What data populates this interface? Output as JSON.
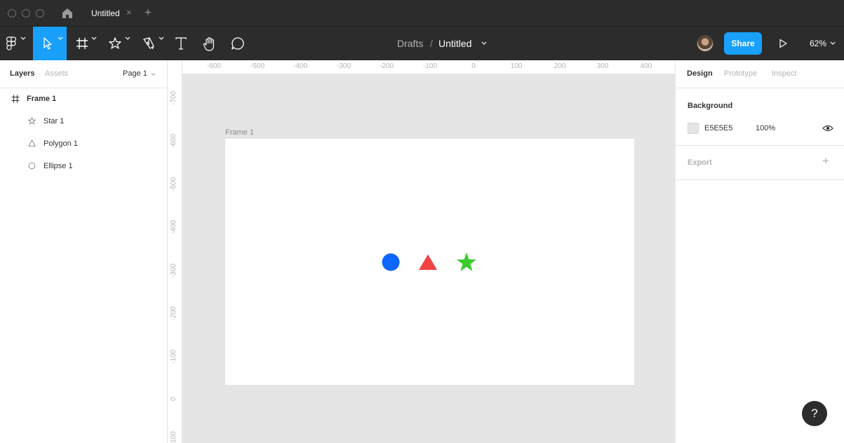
{
  "titlebar": {
    "tab_title": "Untitled",
    "tab_close": "×",
    "new_tab": "+"
  },
  "toolbar": {
    "breadcrumb_project": "Drafts",
    "breadcrumb_sep": "/",
    "file_name": "Untitled",
    "share_label": "Share",
    "zoom": "62%",
    "tools": [
      "main-menu",
      "move",
      "frame",
      "shape",
      "pen",
      "text",
      "hand",
      "comment"
    ],
    "active_tool": "move"
  },
  "left_panel": {
    "tabs": [
      "Layers",
      "Assets"
    ],
    "active_tab": "Layers",
    "page_selector": "Page 1",
    "layers": [
      {
        "name": "Frame 1",
        "icon": "frame-icon",
        "level": 0
      },
      {
        "name": "Star 1",
        "icon": "star-icon",
        "level": 1
      },
      {
        "name": "Polygon 1",
        "icon": "polygon-icon",
        "level": 1
      },
      {
        "name": "Ellipse 1",
        "icon": "ellipse-icon",
        "level": 1
      }
    ]
  },
  "rulers": {
    "horizontal": [
      "-600",
      "-500",
      "-400",
      "-300",
      "-200",
      "-100",
      "0",
      "100",
      "200",
      "300",
      "400"
    ],
    "vertical": [
      "-700",
      "-600",
      "-500",
      "-400",
      "-300",
      "-200",
      "-100",
      "0",
      "100"
    ]
  },
  "canvas": {
    "frame_label": "Frame 1",
    "frame_fill": "#FFFFFF",
    "canvas_bg": "#E5E5E5",
    "shapes": [
      {
        "type": "ellipse",
        "color": "#0D66FF"
      },
      {
        "type": "triangle",
        "color": "#F24343"
      },
      {
        "type": "star",
        "color": "#3CCC2C"
      }
    ]
  },
  "right_panel": {
    "tabs": [
      "Design",
      "Prototype",
      "Inspect"
    ],
    "active_tab": "Design",
    "background_title": "Background",
    "background_hex": "E5E5E5",
    "background_opacity": "100%",
    "export_title": "Export",
    "export_add": "+"
  },
  "help_label": "?",
  "colors": {
    "accent": "#18A0FB",
    "toolbar_bg": "#2C2C2C"
  }
}
